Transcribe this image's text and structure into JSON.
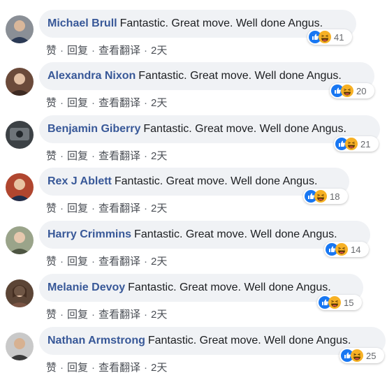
{
  "separator": "·",
  "actions": {
    "like": "赞",
    "reply": "回复",
    "translate": "查看翻译",
    "time": "2天"
  },
  "colors": {
    "author": "#385898",
    "bubble": "#f0f2f5",
    "like_blue": "#1877f2",
    "haha_yellow": "#f7b125"
  },
  "comments": [
    {
      "author": "Michael Brull",
      "text": "Fantastic. Great move. Well done Angus.",
      "reactions": {
        "icons": [
          "like-icon",
          "haha-icon"
        ],
        "count": "41"
      }
    },
    {
      "author": "Alexandra Nixon",
      "text": "Fantastic. Great move. Well done Angus.",
      "reactions": {
        "icons": [
          "like-icon",
          "haha-icon"
        ],
        "count": "20"
      }
    },
    {
      "author": "Benjamin Giberry",
      "text": "Fantastic. Great move. Well done Angus.",
      "reactions": {
        "icons": [
          "like-icon",
          "haha-icon"
        ],
        "count": "21"
      }
    },
    {
      "author": "Rex J Ablett",
      "text": "Fantastic. Great move. Well done Angus.",
      "reactions": {
        "icons": [
          "like-icon",
          "haha-icon"
        ],
        "count": "18"
      }
    },
    {
      "author": "Harry Crimmins",
      "text": "Fantastic. Great move. Well done Angus.",
      "reactions": {
        "icons": [
          "like-icon",
          "haha-icon"
        ],
        "count": "14"
      }
    },
    {
      "author": "Melanie Devoy",
      "text": "Fantastic. Great move. Well done Angus.",
      "reactions": {
        "icons": [
          "like-icon",
          "haha-icon"
        ],
        "count": "15"
      }
    },
    {
      "author": "Nathan Armstrong",
      "text": "Fantastic. Great move. Well done Angus.",
      "reactions": {
        "icons": [
          "like-icon",
          "haha-icon"
        ],
        "count": "25"
      }
    }
  ]
}
